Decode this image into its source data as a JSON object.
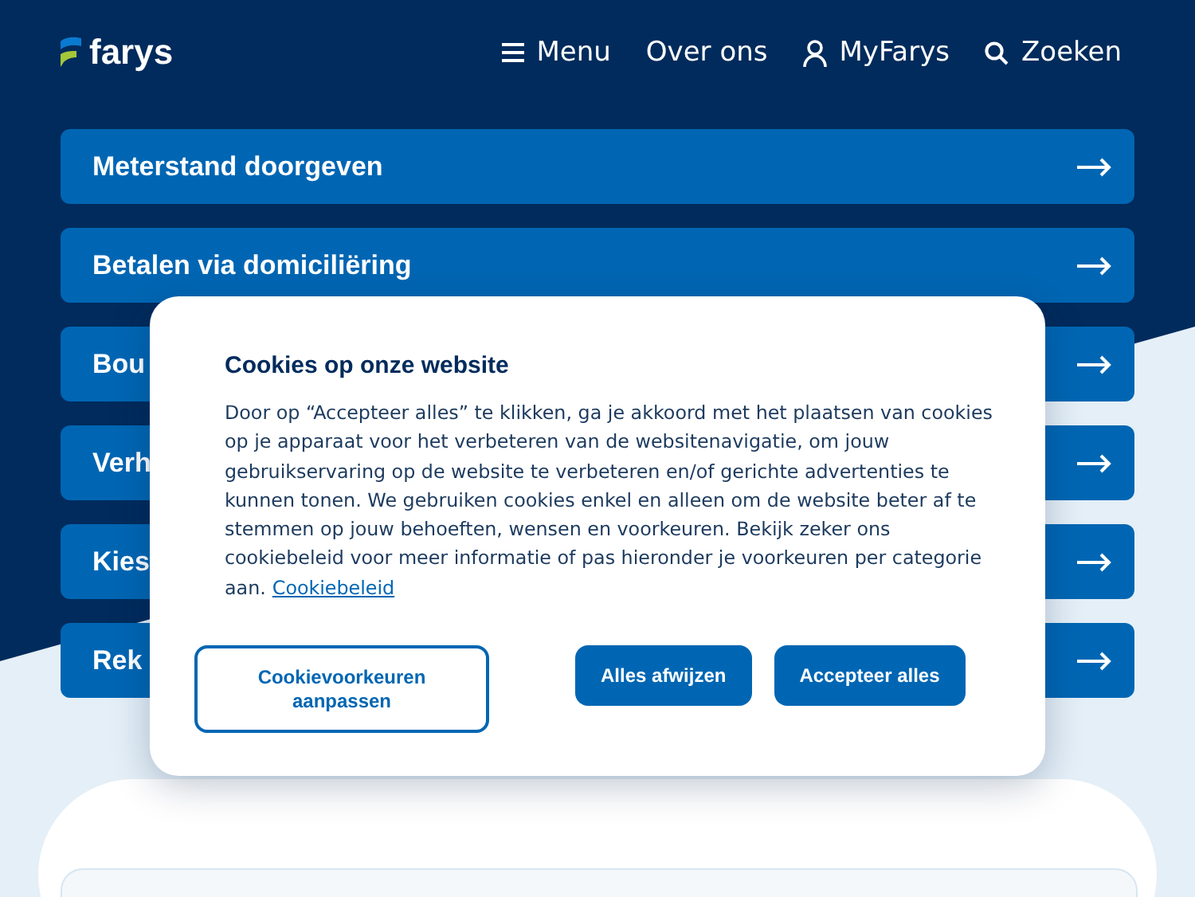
{
  "header": {
    "logo": "farys",
    "nav": [
      {
        "kind": "menu",
        "label": "Menu"
      },
      {
        "kind": "plain",
        "label": "Over ons"
      },
      {
        "kind": "user",
        "label": "MyFarys"
      },
      {
        "kind": "search",
        "label": "Zoeken"
      }
    ]
  },
  "links": [
    {
      "label": "Meterstand doorgeven"
    },
    {
      "label": "Betalen via domiciliëring"
    },
    {
      "label": "Bou"
    },
    {
      "label": "Verh"
    },
    {
      "label": "Kies"
    },
    {
      "label": "Rek"
    }
  ],
  "cookie_dialog": {
    "title": "Cookies op onze website",
    "text": "Door op “Accepteer alles” te klikken, ga je akkoord met het plaatsen van cookies op je apparaat voor het verbeteren van de websitenavigatie, om jouw gebruikservaring op de website te verbeteren en/of gerichte advertenties te kunnen tonen. We gebruiken cookies enkel en alleen om de website beter af te stemmen op jouw behoeften, wensen en voorkeuren. Bekijk zeker ons cookiebeleid voor meer informatie of pas hieronder je voorkeuren per categorie aan.",
    "link": "Cookiebeleid",
    "buttons": [
      {
        "kind": "outline",
        "label": "Cookievoorkeuren aanpassen"
      },
      {
        "kind": "solid",
        "label": "Alles afwijzen"
      },
      {
        "kind": "solid",
        "label": "Accepteer alles"
      }
    ]
  }
}
